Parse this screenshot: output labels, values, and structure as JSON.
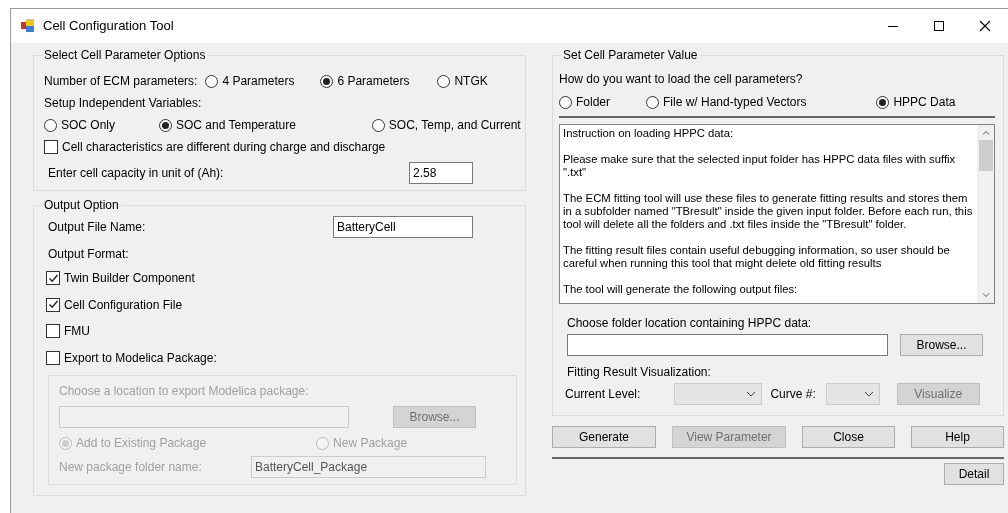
{
  "window": {
    "title": "Cell Configuration Tool"
  },
  "cell_parameter_options": {
    "title": "Select Cell Parameter Options",
    "ecm_label": "Number of ECM parameters:",
    "ecm_options": [
      {
        "label": "4 Parameters",
        "selected": false
      },
      {
        "label": "6 Parameters",
        "selected": true
      },
      {
        "label": "NTGK",
        "selected": false
      }
    ],
    "variables_label": "Setup Independent Variables:",
    "variable_options": [
      {
        "label": "SOC Only",
        "selected": false
      },
      {
        "label": "SOC and Temperature",
        "selected": true
      },
      {
        "label": "SOC, Temp, and Current",
        "selected": false
      }
    ],
    "charge_discharge": {
      "label": "Cell characteristics are different during charge and discharge",
      "checked": false
    },
    "capacity": {
      "label": "Enter cell capacity in unit of (Ah):",
      "value": "2.58"
    }
  },
  "output_option": {
    "title": "Output Option",
    "file_name": {
      "label": "Output File Name:",
      "value": "BatteryCell"
    },
    "format_label": "Output Format:",
    "formats": [
      {
        "label": "Twin Builder Component",
        "checked": true
      },
      {
        "label": "Cell Configuration File",
        "checked": true
      },
      {
        "label": "FMU",
        "checked": false
      },
      {
        "label": "Export to Modelica Package:",
        "checked": false
      }
    ],
    "modelica": {
      "disabled": true,
      "label": "Choose a location to export Modelica package:",
      "browse": "Browse...",
      "package_options": [
        {
          "label": "Add to Existing Package",
          "selected": true
        },
        {
          "label": "New Package",
          "selected": false
        }
      ],
      "folder_name": {
        "label": "New package folder name:",
        "value": "BatteryCell_Package"
      }
    }
  },
  "set_value": {
    "title": "Set Cell Parameter Value",
    "question": "How do you want to load the cell parameters?",
    "load_options": [
      {
        "label": "Folder",
        "selected": false
      },
      {
        "label": "File w/ Hand-typed Vectors",
        "selected": false
      },
      {
        "label": "HPPC Data",
        "selected": true
      }
    ],
    "instructions": [
      "Instruction on loading HPPC data:",
      "Please make sure that the selected input folder has HPPC data files with suffix \".txt\"",
      "The ECM fitting tool will use these files to generate fitting results and stores them in a subfolder named \"TBresult\" inside the given input folder. Before each run, this tool will delete all the folders and .txt files inside the \"TBresult\" folder.",
      "The fitting result files contain useful debugging information, so user should be careful when running this tool that might delete old fitting results",
      "The tool will generate the following output files:"
    ],
    "folder_label": "Choose folder location containing HPPC data:",
    "browse": {
      "label": "Browse...",
      "disabled": false
    },
    "visualization_label": "Fitting Result Visualization:",
    "current_level_label": "Current Level:",
    "curve_label": "Curve #:",
    "visualize": {
      "label": "Visualize",
      "disabled": true
    }
  },
  "buttons": [
    {
      "label": "Generate",
      "disabled": false
    },
    {
      "label": "View Parameter",
      "disabled": true
    },
    {
      "label": "Close",
      "disabled": false
    },
    {
      "label": "Help",
      "disabled": false
    }
  ],
  "detail_button": {
    "label": "Detail",
    "disabled": false
  }
}
